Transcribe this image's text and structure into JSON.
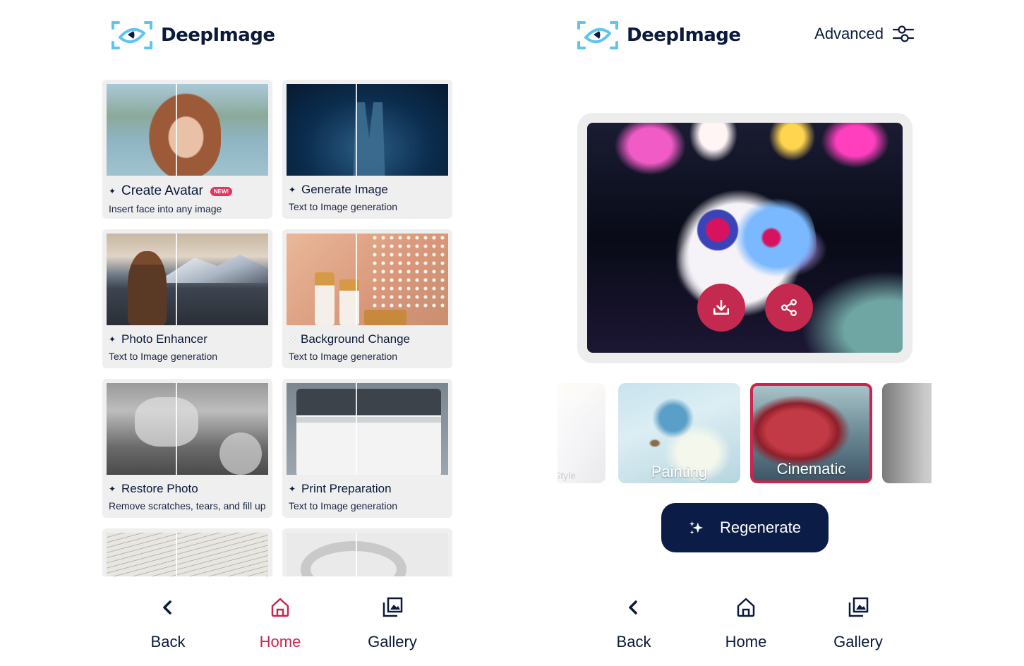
{
  "brand": {
    "name": "DeepImage",
    "logo_icon": "eye-scan-icon",
    "colors": {
      "navy": "#0b1a3a",
      "accent": "#c8264e",
      "logo_blue": "#5ec4f2",
      "badge": "#e7335d",
      "card_bg": "#efefef",
      "button_bg": "#0b1d47"
    }
  },
  "left_screen": {
    "tools": [
      {
        "title": "Create Avatar",
        "badge": "NEW!",
        "subtitle": "Insert face into any image",
        "icon": "sparkle-icon"
      },
      {
        "title": "Generate Image",
        "subtitle": "Text to Image generation",
        "icon": "sparkle-icon"
      },
      {
        "title": "Photo Enhancer",
        "subtitle": "Text to Image generation",
        "icon": "sparkle-icon"
      },
      {
        "title": "Background Change",
        "subtitle": "Text to Image generation",
        "icon": "transparency-icon"
      },
      {
        "title": "Restore Photo",
        "subtitle": "Remove scratches, tears, and fill up holes",
        "icon": "sparkle-icon"
      },
      {
        "title": "Print Preparation",
        "subtitle": "Text to Image generation",
        "icon": "sparkle-icon"
      }
    ],
    "nav": {
      "back": "Back",
      "home": "Home",
      "gallery": "Gallery",
      "active": "home"
    }
  },
  "right_screen": {
    "advanced_label": "Advanced",
    "advanced_icon": "sliders-icon",
    "actions": {
      "download_icon": "download-icon",
      "share_icon": "share-icon"
    },
    "styles": [
      {
        "label": "Style",
        "selected": false
      },
      {
        "label": "Painting",
        "selected": false
      },
      {
        "label": "Cinematic",
        "selected": true
      },
      {
        "label": "",
        "selected": false
      }
    ],
    "regenerate_label": "Regenerate",
    "nav": {
      "back": "Back",
      "home": "Home",
      "gallery": "Gallery",
      "active": "none"
    }
  }
}
